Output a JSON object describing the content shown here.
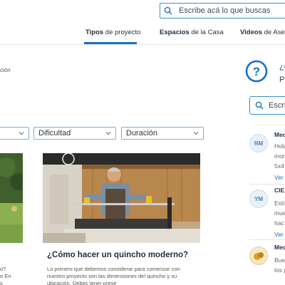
{
  "header": {
    "search_placeholder": "Escribe acá lo que buscas"
  },
  "nav": {
    "items": [
      {
        "bold": "Tipos",
        "rest": " de proyecto"
      },
      {
        "bold": "Espacios",
        "rest": " de la Casa"
      },
      {
        "bold": "Videos",
        "rest": " de Ases"
      }
    ]
  },
  "breadcrumb_fragment": "ción",
  "help": {
    "line1": "¿C",
    "line2": "P"
  },
  "sidebar_search": {
    "text": "Escrib"
  },
  "filters": [
    {
      "label": ""
    },
    {
      "label": "Dificultad"
    },
    {
      "label": "Duración"
    }
  ],
  "cards": [
    {
      "desc_lines": [
        "o?",
        "o En",
        "s"
      ]
    },
    {
      "title": "¿Cómo hacer un quincho moderno?",
      "desc": "Lo primero que debemos considerar para comenzar con nuestro proyecto son las dimensiones del quincho y su ubicación. Debes tener prese"
    }
  ],
  "comments": [
    {
      "initials": "RM",
      "name": "Mec",
      "lines": [
        "Hola",
        "mon",
        "5x4"
      ],
      "link": "Ver"
    },
    {
      "initials": "YM",
      "name": "CIE",
      "lines": [
        "Esti",
        "mue",
        "hac"
      ],
      "link": "Ver"
    },
    {
      "initials": "",
      "name": "Mec",
      "lines": [
        "Bue",
        "los p"
      ],
      "link": ""
    }
  ],
  "colors": {
    "accent": "#1a6fc4",
    "border": "#7aaedb",
    "help_icon": "#1a6fc4"
  }
}
